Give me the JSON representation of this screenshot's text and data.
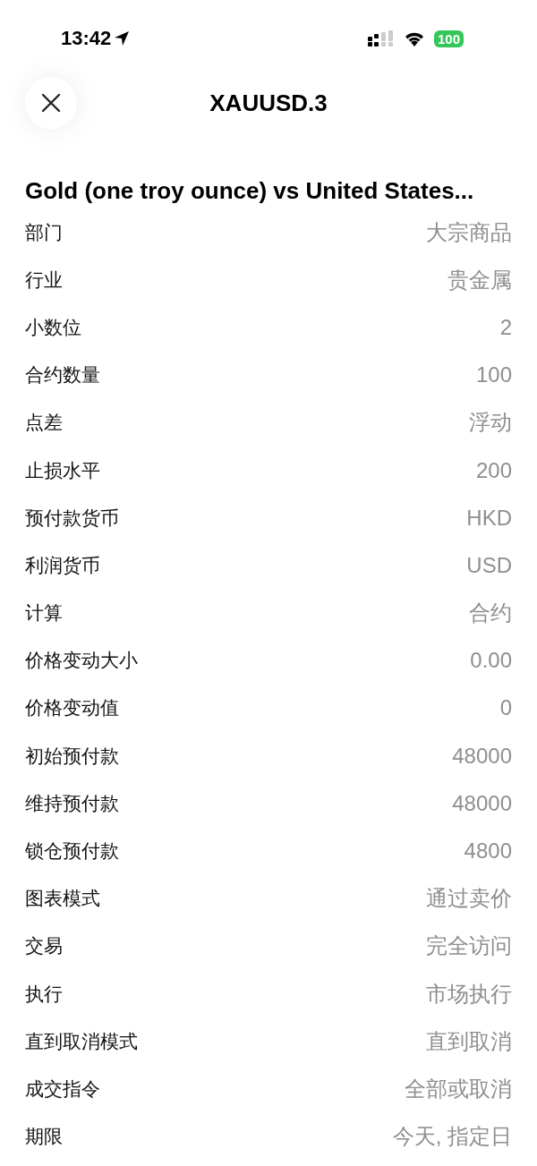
{
  "status_bar": {
    "time": "13:42",
    "battery": "100"
  },
  "header": {
    "title": "XAUUSD.3"
  },
  "heading": "Gold (one troy ounce) vs United States...",
  "rows": [
    {
      "label": "部门",
      "value": "大宗商品"
    },
    {
      "label": "行业",
      "value": "贵金属"
    },
    {
      "label": "小数位",
      "value": "2"
    },
    {
      "label": "合约数量",
      "value": "100"
    },
    {
      "label": "点差",
      "value": "浮动"
    },
    {
      "label": "止损水平",
      "value": "200"
    },
    {
      "label": "预付款货币",
      "value": "HKD"
    },
    {
      "label": "利润货币",
      "value": "USD"
    },
    {
      "label": "计算",
      "value": "合约"
    },
    {
      "label": "价格变动大小",
      "value": "0.00"
    },
    {
      "label": "价格变动值",
      "value": "0"
    },
    {
      "label": "初始预付款",
      "value": "48000"
    },
    {
      "label": "维持预付款",
      "value": "48000"
    },
    {
      "label": "锁仓预付款",
      "value": "4800"
    },
    {
      "label": "图表模式",
      "value": "通过卖价"
    },
    {
      "label": "交易",
      "value": "完全访问"
    },
    {
      "label": "执行",
      "value": "市场执行"
    },
    {
      "label": "直到取消模式",
      "value": "直到取消"
    },
    {
      "label": "成交指令",
      "value": "全部或取消"
    },
    {
      "label": "期限",
      "value": "今天, 指定日"
    }
  ]
}
